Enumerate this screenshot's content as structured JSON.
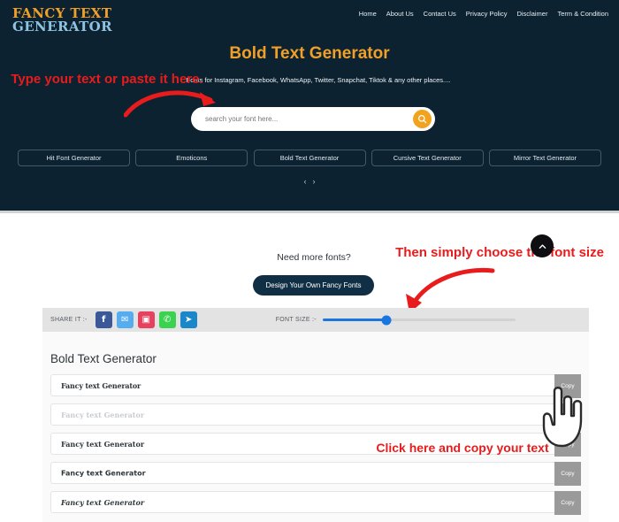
{
  "site": {
    "logo_line1": "FANCY TEXT",
    "logo_line2": "GENERATOR",
    "accent_orange": "#f0a028",
    "accent_blue": "#8fc3e0",
    "hero_bg": "#0c2230",
    "annotation_red": "#e81c1c"
  },
  "nav": {
    "items": [
      {
        "label": "Home"
      },
      {
        "label": "About Us"
      },
      {
        "label": "Contact Us"
      },
      {
        "label": "Privacy Policy"
      },
      {
        "label": "Disclaimer"
      },
      {
        "label": "Term & Condition"
      }
    ]
  },
  "hero": {
    "title": "Bold Text Generator",
    "subtitle": "Fonts for Instagram, Facebook, WhatsApp, Twitter, Snapchat, Tiktok & any other places....",
    "search": {
      "placeholder": "search your font here...",
      "value": "",
      "button_icon": "search-icon"
    },
    "categories": [
      {
        "label": "Hit Font Generator"
      },
      {
        "label": "Emoticons"
      },
      {
        "label": "Bold Text Generator"
      },
      {
        "label": "Cursive Text Generator"
      },
      {
        "label": "Mirror Text Generator"
      }
    ],
    "carousel": {
      "prev": "‹",
      "next": "›"
    }
  },
  "annotations": {
    "type_here": "Type your text or paste it here.",
    "choose_size": "Then simply choose the font size",
    "click_copy": "Click here and copy your text"
  },
  "promo": {
    "heading": "Need more fonts?",
    "button_label": "Design Your Own Fancy Fonts"
  },
  "scroll_top": {
    "icon": "chevron-up-icon"
  },
  "toolbar": {
    "share_label": "SHARE IT :-",
    "socials": [
      {
        "name": "facebook-icon",
        "glyph": "f",
        "color": "#3b5998"
      },
      {
        "name": "twitter-icon",
        "glyph": "✉",
        "color": "#55acee"
      },
      {
        "name": "instagram-icon",
        "glyph": "▣",
        "color": "#e8415e"
      },
      {
        "name": "whatsapp-icon",
        "glyph": "✆",
        "color": "#3ad24f"
      },
      {
        "name": "telegram-icon",
        "glyph": "➤",
        "color": "#1b87c9"
      }
    ],
    "font_size_label": "FONT SIZE :-",
    "font_size_percent": 33,
    "slider_color": "#1c76e0"
  },
  "results": {
    "title": "Bold Text Generator",
    "copy_label": "Copy",
    "rows": [
      {
        "text": "Fancy text Generator",
        "style": "f-fraktur"
      },
      {
        "text": "Fancy text Generator",
        "style": "f-light"
      },
      {
        "text": "Fancy text Generator",
        "style": "f-serif"
      },
      {
        "text": "Fancy text Generator",
        "style": "f-sans"
      },
      {
        "text": "Fancy text Generator",
        "style": "f-italic"
      }
    ]
  }
}
